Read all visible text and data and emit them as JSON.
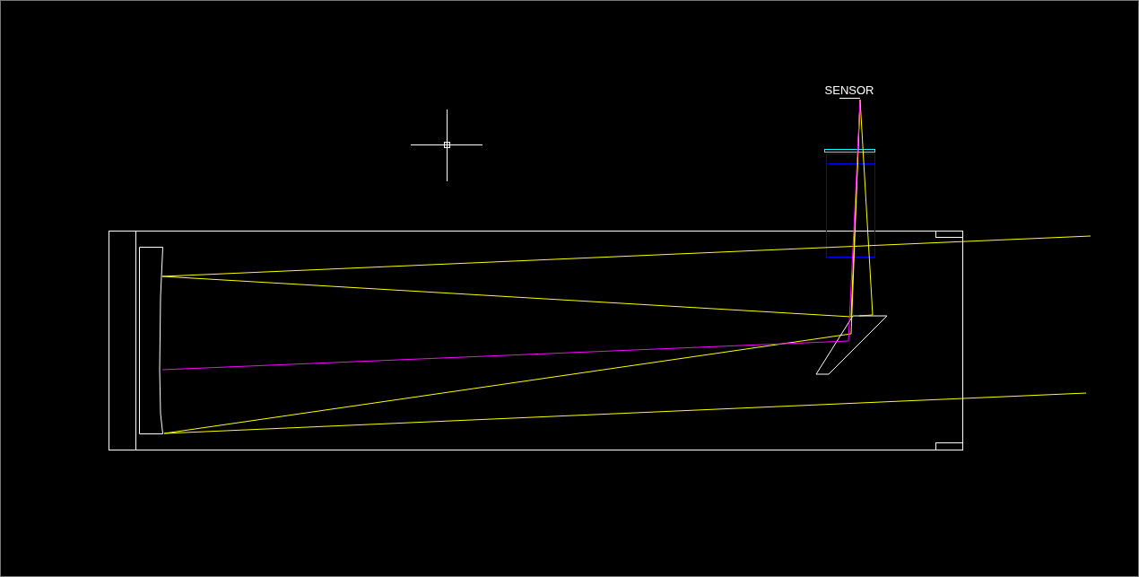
{
  "drawing": {
    "sensor_label": "SENSOR"
  }
}
